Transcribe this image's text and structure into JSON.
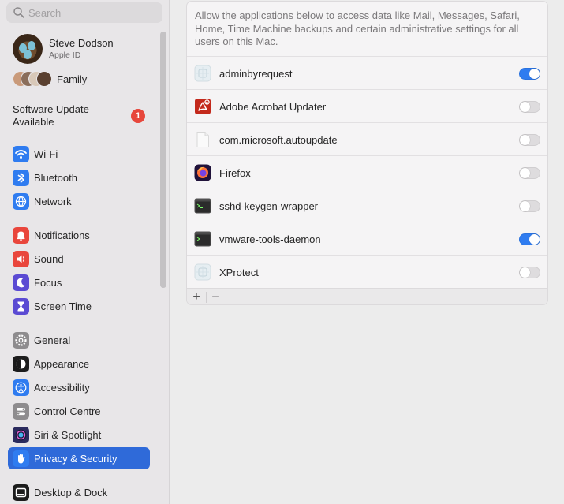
{
  "sidebar": {
    "search_placeholder": "Search",
    "profile": {
      "name": "Steve Dodson",
      "subtitle": "Apple ID"
    },
    "family_label": "Family",
    "software_update": {
      "label": "Software Update Available",
      "badge": "1"
    },
    "items": [
      {
        "label": "Wi-Fi",
        "icon": "wifi-icon",
        "color": "#2f7cf0"
      },
      {
        "label": "Bluetooth",
        "icon": "bluetooth-icon",
        "color": "#2f7cf0"
      },
      {
        "label": "Network",
        "icon": "globe-icon",
        "color": "#2f7cf0"
      },
      {
        "label": "Notifications",
        "icon": "bell-icon",
        "color": "#e9463c"
      },
      {
        "label": "Sound",
        "icon": "speaker-icon",
        "color": "#e9463c"
      },
      {
        "label": "Focus",
        "icon": "moon-icon",
        "color": "#5b4bd3"
      },
      {
        "label": "Screen Time",
        "icon": "hourglass-icon",
        "color": "#5b4bd3"
      },
      {
        "label": "General",
        "icon": "gear-icon",
        "color": "#8e8c8e"
      },
      {
        "label": "Appearance",
        "icon": "appearance-icon",
        "color": "#1c1c1c"
      },
      {
        "label": "Accessibility",
        "icon": "accessibility-icon",
        "color": "#2f7cf0"
      },
      {
        "label": "Control Centre",
        "icon": "control-centre-icon",
        "color": "#8e8c8e"
      },
      {
        "label": "Siri & Spotlight",
        "icon": "siri-icon",
        "color": "#2b2b5e"
      },
      {
        "label": "Privacy & Security",
        "icon": "hand-icon",
        "color": "#2f7cf0",
        "selected": true
      },
      {
        "label": "Desktop & Dock",
        "icon": "dock-icon",
        "color": "#1c1c1c"
      }
    ]
  },
  "main": {
    "description": "Allow the applications below to access data like Mail, Messages, Safari, Home, Time Machine backups and certain administrative settings for all users on this Mac.",
    "apps": [
      {
        "name": "adminbyrequest",
        "icon": "generic-app-icon",
        "enabled": true
      },
      {
        "name": "Adobe Acrobat Updater",
        "icon": "acrobat-icon",
        "enabled": false
      },
      {
        "name": "com.microsoft.autoupdate",
        "icon": "document-icon",
        "enabled": false
      },
      {
        "name": "Firefox",
        "icon": "firefox-icon",
        "enabled": false
      },
      {
        "name": "sshd-keygen-wrapper",
        "icon": "terminal-icon",
        "enabled": false
      },
      {
        "name": "vmware-tools-daemon",
        "icon": "terminal-icon",
        "enabled": true
      },
      {
        "name": "XProtect",
        "icon": "generic-app-icon",
        "enabled": false
      }
    ],
    "add_label": "+",
    "remove_label": "−"
  }
}
